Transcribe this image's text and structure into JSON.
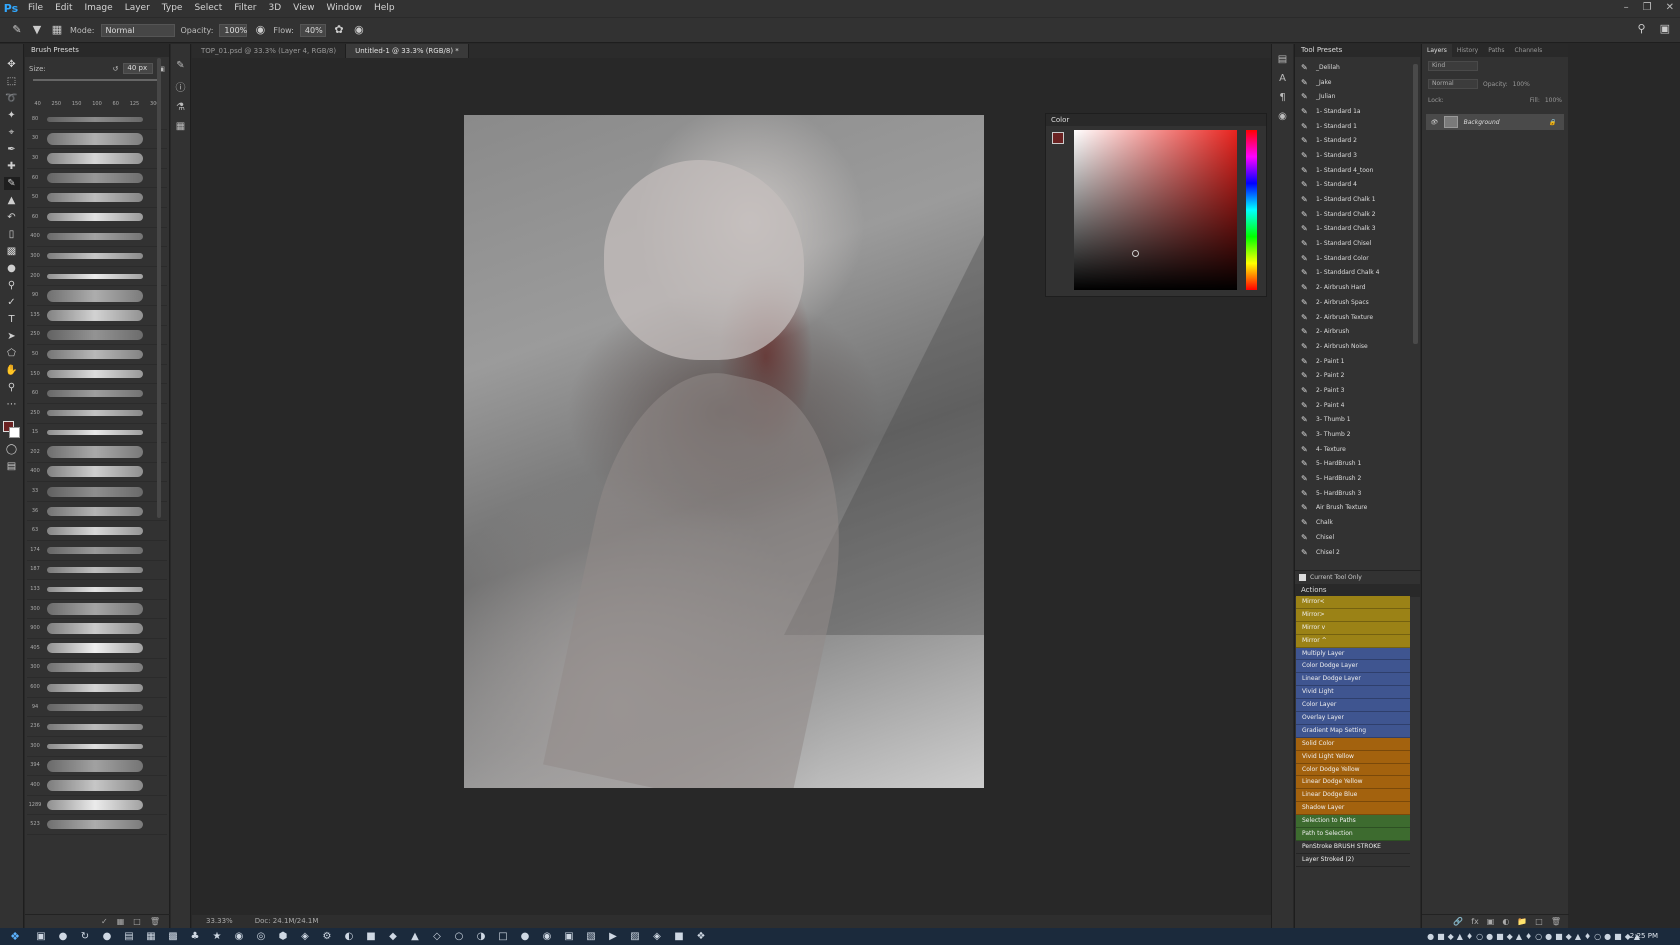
{
  "menubar": {
    "logo": "Ps",
    "items": [
      "File",
      "Edit",
      "Image",
      "Layer",
      "Type",
      "Select",
      "Filter",
      "3D",
      "View",
      "Window",
      "Help"
    ]
  },
  "options_bar": {
    "mode_label": "Mode:",
    "mode_value": "Normal",
    "opacity_label": "Opacity:",
    "opacity_value": "100%",
    "flow_label": "Flow:",
    "flow_value": "40%"
  },
  "brush_presets": {
    "title": "Brush Presets",
    "size_label": "Size:",
    "size_value": "40 px",
    "preset_sizes": [
      "40",
      "250",
      "150",
      "100",
      "60",
      "125",
      "300"
    ],
    "stroke_numbers": [
      "80",
      "30",
      "30",
      "60",
      "50",
      "60",
      "400",
      "300",
      "200",
      "90",
      "135",
      "250",
      "50",
      "150",
      "60",
      "250",
      "15",
      "202",
      "400",
      "33",
      "36",
      "63",
      "174",
      "187",
      "133",
      "300",
      "900",
      "405",
      "300",
      "600",
      "94",
      "236",
      "300",
      "394",
      "400",
      "1289",
      "523"
    ]
  },
  "doc_tabs": [
    {
      "label": "TOP_01.psd @ 33.3% (Layer 4, RGB/8)",
      "active": false
    },
    {
      "label": "Untitled-1 @ 33.3% (RGB/8) *",
      "active": true
    }
  ],
  "status": {
    "zoom": "33.33%",
    "doc": "Doc: 24.1M/24.1M"
  },
  "color_panel": {
    "title": "Color",
    "fg_color": "#6b2222",
    "bg_color": "#ffffff",
    "hue_color": "#e8231e"
  },
  "tool_presets": {
    "title": "Tool Presets",
    "items": [
      "_Delilah",
      "_Jake",
      "_Julian",
      "1- Standard 1a",
      "1- Standard 1",
      "1- Standard 2",
      "1- Standard 3",
      "1- Standard 4_toon",
      "1- Standard 4",
      "1- Standard Chalk 1",
      "1- Standard Chalk 2",
      "1- Standard Chalk 3",
      "1- Standard Chisel",
      "1- Standard Color",
      "1- Standdard Chalk 4",
      "2- Airbrush Hard",
      "2- Airbrush Spacs",
      "2- Airbrush Texture",
      "2- Airbrush",
      "2- Airbrush Noise",
      "2- Paint 1",
      "2- Paint 2",
      "2- Paint 3",
      "2- Paint 4",
      "3- Thumb 1",
      "3- Thumb 2",
      "4- Texture",
      "5- HardBrush 1",
      "5- HardBrush 2",
      "5- HardBrush 3",
      "Air Brush Texture",
      "Chalk",
      "Chisel",
      "Chisel 2"
    ],
    "footer": "Current Tool Only"
  },
  "actions": {
    "title": "Actions",
    "items": [
      {
        "label": "Mirror<",
        "color": "#9b8216"
      },
      {
        "label": "Mirror>",
        "color": "#9b8216"
      },
      {
        "label": "Mirror v",
        "color": "#9b8216"
      },
      {
        "label": "Mirror ^",
        "color": "#9b8216"
      },
      {
        "label": "Multiply Layer",
        "color": "#3f5590"
      },
      {
        "label": "Color Dodge Layer",
        "color": "#3f5590"
      },
      {
        "label": "Linear Dodge Layer",
        "color": "#3f5590"
      },
      {
        "label": "Vivid Light",
        "color": "#3f5590"
      },
      {
        "label": "Color Layer",
        "color": "#3f5590"
      },
      {
        "label": "Overlay Layer",
        "color": "#3f5590"
      },
      {
        "label": "Gradient Map Setting",
        "color": "#3f5590"
      },
      {
        "label": "Solid Color",
        "color": "#a3620e"
      },
      {
        "label": "Vivid Light Yellow",
        "color": "#a3620e"
      },
      {
        "label": "Color Dodge Yellow",
        "color": "#a3620e"
      },
      {
        "label": "Linear Dodge Yellow",
        "color": "#a3620e"
      },
      {
        "label": "Linear Dodge Blue",
        "color": "#a3620e"
      },
      {
        "label": "Shadow Layer",
        "color": "#a3620e"
      },
      {
        "label": "Selection to Paths",
        "color": "#3d6b2f"
      },
      {
        "label": "Path to Selection",
        "color": "#3d6b2f"
      },
      {
        "label": "PenStroke BRUSH STROKE",
        "color": "#323232"
      },
      {
        "label": "Layer Stroked (2)",
        "color": "#323232"
      }
    ]
  },
  "layers_panel": {
    "tabs": [
      "Layers",
      "History",
      "Paths",
      "Channels"
    ],
    "kind_label": "Kind",
    "blend_mode": "Normal",
    "opacity_label": "Opacity:",
    "opacity_value": "100%",
    "lock_label": "Lock:",
    "fill_label": "Fill:",
    "fill_value": "100%",
    "layer_name": "Background"
  },
  "taskbar": {
    "clock": "2:25 PM"
  }
}
